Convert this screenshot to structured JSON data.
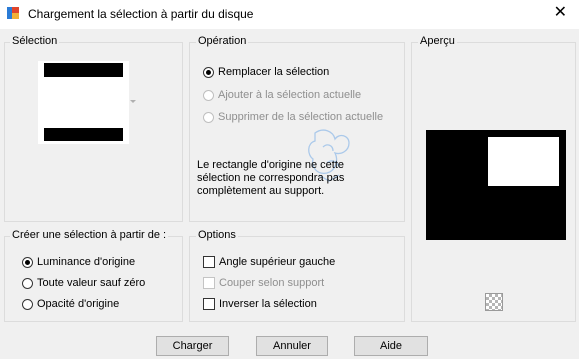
{
  "window": {
    "title": "Chargement la sélection à partir du disque",
    "close_glyph": "✕"
  },
  "selection": {
    "label": "Sélection"
  },
  "operation": {
    "label": "Opération",
    "options": [
      {
        "label": "Remplacer la sélection",
        "selected": true,
        "enabled": true
      },
      {
        "label": "Ajouter à la sélection actuelle",
        "selected": false,
        "enabled": false
      },
      {
        "label": "Supprimer de la sélection actuelle",
        "selected": false,
        "enabled": false
      }
    ],
    "message": "Le rectangle d'origine ne cette sélection ne correspondra pas complètement au support."
  },
  "preview": {
    "label": "Aperçu"
  },
  "create_from": {
    "label": "Créer une sélection à partir de :",
    "options": [
      {
        "label": "Luminance d'origine",
        "selected": true
      },
      {
        "label": "Toute valeur sauf zéro",
        "selected": false
      },
      {
        "label": "Opacité d'origine",
        "selected": false
      }
    ]
  },
  "options": {
    "label": "Options",
    "items": [
      {
        "label": "Angle supérieur gauche",
        "checked": false,
        "enabled": true
      },
      {
        "label": "Couper selon support",
        "checked": false,
        "enabled": false
      },
      {
        "label": "Inverser la sélection",
        "checked": false,
        "enabled": true
      }
    ]
  },
  "buttons": {
    "load": "Charger",
    "cancel": "Annuler",
    "help": "Aide"
  },
  "colors": {
    "titlebar": "#ffffff",
    "dialog_bg": "#f0f0f0",
    "preview_black": "#000000",
    "preview_white": "#ffffff",
    "group_border": "#dcdcdc"
  },
  "icons": [
    "app-icon",
    "close-icon",
    "dropdown-arrow-icon",
    "transparency-icon",
    "watermark-icon"
  ]
}
